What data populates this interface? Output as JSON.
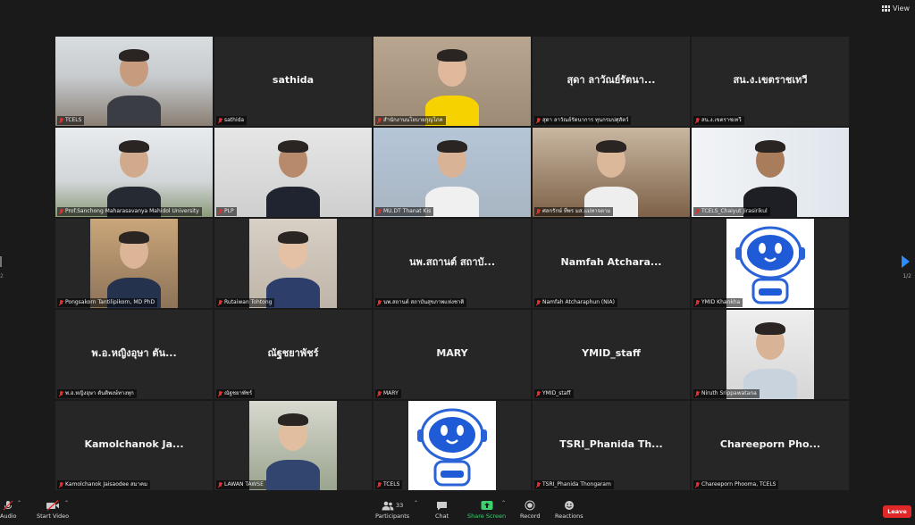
{
  "header": {
    "view_label": "View"
  },
  "pagination": {
    "current": "2",
    "next": "1/2"
  },
  "colors": {
    "accent": "#2d8cff",
    "leave": "#e02828",
    "share": "#3bd16f",
    "active_speaker": "#e6d94a"
  },
  "participants": [
    {
      "label": "TCELS",
      "display": "",
      "type": "video",
      "active": true
    },
    {
      "label": "sathida",
      "display": "sathida",
      "type": "name"
    },
    {
      "label": "สำนักงานนโยบายกุญโภค",
      "display": "",
      "type": "video"
    },
    {
      "label": "สุดา ลาวัณย์รัตนาการ ทุนกรมปศุสัตว์",
      "display": "สุดา ลาวัณย์รัตนา...",
      "type": "name"
    },
    {
      "label": "สน.ง.เขตราชเทวี",
      "display": "สน.ง.เขตราชเทวี",
      "type": "name"
    },
    {
      "label": "Prof.Sanchong Maharasavanya Mahidol University",
      "display": "",
      "type": "video"
    },
    {
      "label": "PLP",
      "display": "",
      "type": "video"
    },
    {
      "label": "MU.DT Thanat Kis",
      "display": "",
      "type": "video"
    },
    {
      "label": "ศลกรักษ์ ที่พร มส.แม่ทาจตาม",
      "display": "",
      "type": "video"
    },
    {
      "label": "TCELS_Chaiyut Jirasirikul",
      "display": "",
      "type": "video"
    },
    {
      "label": "Pongsakorn Tantilipikorn, MD PhD",
      "display": "",
      "type": "video"
    },
    {
      "label": "Rutaiwan Tohtong",
      "display": "",
      "type": "video"
    },
    {
      "label": "นพ.สถานต์ สถาบันสุขภาพแห่งชาติ",
      "display": "นพ.สถานต์ สถาบั...",
      "type": "name"
    },
    {
      "label": "Namfah Atcharaphun (NIA)",
      "display": "Namfah Atchara...",
      "type": "name"
    },
    {
      "label": "YMID Khankha",
      "display": "",
      "type": "robot"
    },
    {
      "label": "พ.อ.หญิงอุษา ตันติพงษ์ทางทุก",
      "display": "พ.อ.หญิงอุษา ตัน...",
      "type": "name"
    },
    {
      "label": "ณัฐชยาพัชร์",
      "display": "ณัฐชยาพัชร์",
      "type": "name"
    },
    {
      "label": "MARY",
      "display": "MARY",
      "type": "name"
    },
    {
      "label": "YMID_staff",
      "display": "YMID_staff",
      "type": "name"
    },
    {
      "label": "Niruth Srippawatana",
      "display": "",
      "type": "video"
    },
    {
      "label": "Kamolchanok Jaisaodee สมาคม",
      "display": "Kamolchanok Ja...",
      "type": "name"
    },
    {
      "label": "LAWAN TAWSE",
      "display": "",
      "type": "video"
    },
    {
      "label": "TCELS",
      "display": "",
      "type": "robot"
    },
    {
      "label": "TSRI_Phanida Thongaram",
      "display": "TSRI_Phanida Th...",
      "type": "name"
    },
    {
      "label": "Chareeporn Phooma, TCELS",
      "display": "Chareeporn Pho...",
      "type": "name"
    }
  ],
  "toolbar": {
    "audio": "Audio",
    "start_video": "Start Video",
    "participants": "Participants",
    "participants_count": "33",
    "chat": "Chat",
    "share_screen": "Share Screen",
    "record": "Record",
    "reactions": "Reactions",
    "leave": "Leave",
    "audio_badge": "1"
  }
}
